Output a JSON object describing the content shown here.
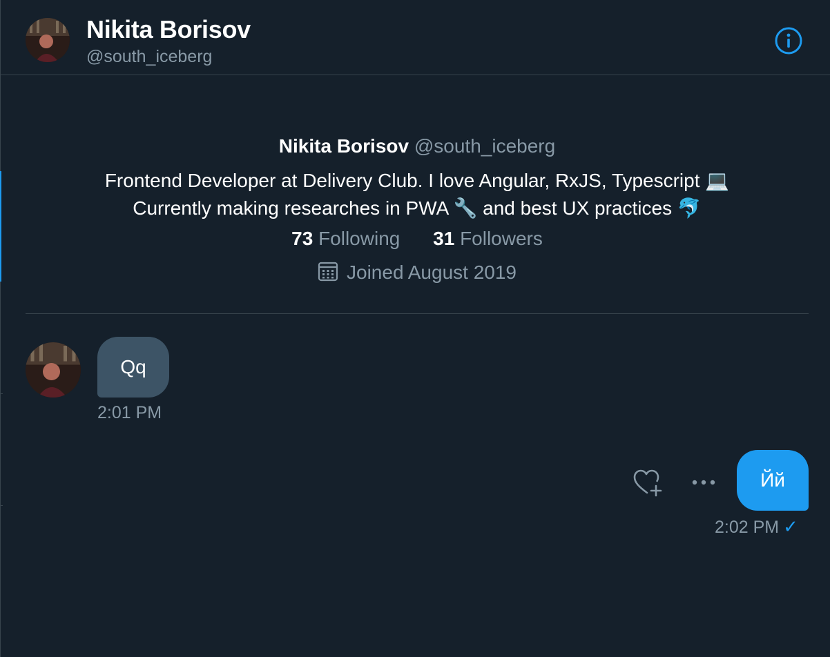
{
  "header": {
    "name": "Nikita Borisov",
    "handle": "@south_iceberg",
    "info_icon": "info-circle-icon"
  },
  "profile": {
    "name": "Nikita Borisov",
    "handle": "@south_iceberg",
    "bio_line1": "Frontend Developer at Delivery Club. I love Angular, RxJS, Typescript",
    "bio_line1_emoji": "💻",
    "bio_line2_a": "Currently making researches in PWA",
    "bio_line2_emoji1": "🔧",
    "bio_line2_b": "and best UX practices",
    "bio_line2_emoji2": "🐬",
    "following_count": "73",
    "following_label": "Following",
    "followers_count": "31",
    "followers_label": "Followers",
    "joined": "Joined August 2019",
    "calendar_icon": "calendar-icon"
  },
  "messages": [
    {
      "direction": "incoming",
      "text": "Qq",
      "time": "2:01 PM"
    },
    {
      "direction": "outgoing",
      "text": "Йй",
      "time": "2:02 PM",
      "status_icon": "checkmark-icon",
      "status_glyph": "✓"
    }
  ],
  "actions": {
    "like_icon": "heart-plus-icon",
    "more_icon": "more-horizontal-icon"
  },
  "colors": {
    "background": "#15202b",
    "accent": "#1d9bf0",
    "incoming_bubble": "#3d5466",
    "secondary_text": "#8899a6",
    "border": "#38444d"
  }
}
